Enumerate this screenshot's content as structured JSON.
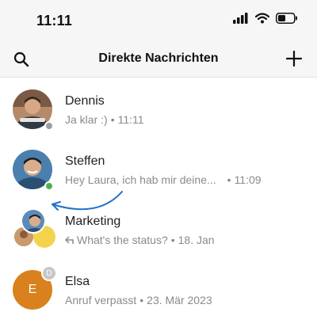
{
  "status_bar": {
    "time": "11:11",
    "icons": [
      "cellular-signal-icon",
      "wifi-icon",
      "battery-icon"
    ]
  },
  "header": {
    "title": "Direkte Nachrichten",
    "left_icon": "search-icon",
    "right_icon": "plus-icon"
  },
  "chats": [
    {
      "name": "Dennis",
      "message": "Ja klar :)",
      "separator": "•",
      "time": "11:11",
      "presence": "offline"
    },
    {
      "name": "Steffen",
      "message": "Hey Laura, ich hab mir deine...",
      "separator": "•",
      "time": "11:09",
      "presence": "online"
    },
    {
      "name": "Marketing",
      "message": "What's the status?",
      "separator": "•",
      "time": "18. Jan",
      "reply_icon": "reply-arrow-icon"
    },
    {
      "name": "Elsa",
      "avatar_initial": "E",
      "badge_initial": "D",
      "message": "Anruf verpasst",
      "separator": "•",
      "time": "23. Mär 2023"
    }
  ],
  "colors": {
    "online": "#4cb24c",
    "offline": "#9e9e9e",
    "arrow": "#1f73c7",
    "elsa_avatar": "#d9811c",
    "accent_text": "#8a8a8a"
  }
}
